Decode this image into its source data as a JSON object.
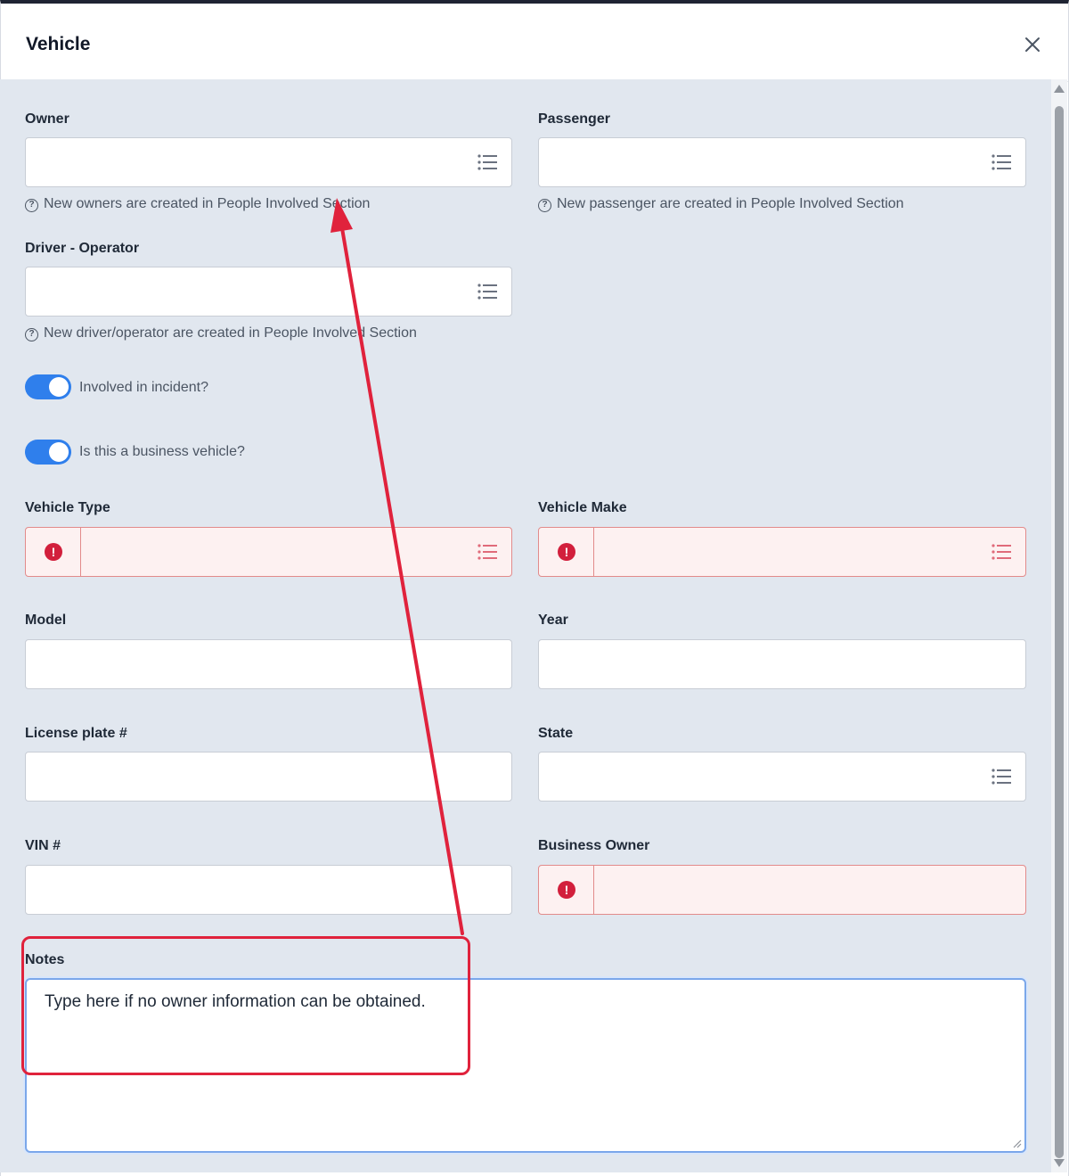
{
  "modal": {
    "title": "Vehicle"
  },
  "fields": {
    "owner": {
      "label": "Owner",
      "hint": "New owners are created in People Involved Section"
    },
    "passenger": {
      "label": "Passenger",
      "hint": "New passenger are created in People Involved Section"
    },
    "driver": {
      "label": "Driver - Operator",
      "hint": "New driver/operator are created in People Involved Section"
    },
    "vehicle_type": {
      "label": "Vehicle Type"
    },
    "vehicle_make": {
      "label": "Vehicle Make"
    },
    "model": {
      "label": "Model"
    },
    "year": {
      "label": "Year"
    },
    "license_plate": {
      "label": "License plate #"
    },
    "state": {
      "label": "State"
    },
    "vin": {
      "label": "VIN #"
    },
    "business_owner": {
      "label": "Business Owner"
    },
    "notes": {
      "label": "Notes",
      "value": "Type here if no owner information can be obtained."
    }
  },
  "toggles": {
    "involved": {
      "label": "Involved in incident?",
      "on": true
    },
    "business": {
      "label": "Is this a business vehicle?",
      "on": true
    }
  },
  "colors": {
    "accent": "#2f7fec",
    "error": "#d21f3c",
    "annotation": "#e0223c",
    "panel": "#e1e7ef"
  },
  "icons": {
    "close": "close-icon",
    "list": "list-icon",
    "help": "help-circle-icon",
    "error": "error-circle-icon"
  }
}
